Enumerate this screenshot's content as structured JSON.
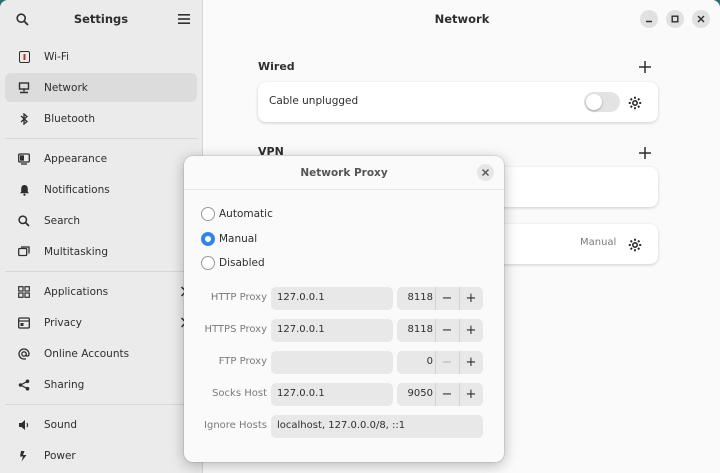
{
  "sidebar": {
    "title": "Settings",
    "items": [
      {
        "label": "Wi-Fi",
        "icon": "wifi-icon"
      },
      {
        "label": "Network",
        "icon": "network-icon",
        "selected": true
      },
      {
        "label": "Bluetooth",
        "icon": "bluetooth-icon"
      },
      {
        "label": "Appearance",
        "icon": "appearance-icon"
      },
      {
        "label": "Notifications",
        "icon": "bell-icon"
      },
      {
        "label": "Search",
        "icon": "search-icon"
      },
      {
        "label": "Multitasking",
        "icon": "multitasking-icon"
      },
      {
        "label": "Applications",
        "icon": "applications-icon"
      },
      {
        "label": "Privacy",
        "icon": "hand-icon"
      },
      {
        "label": "Online Accounts",
        "icon": "at-icon"
      },
      {
        "label": "Sharing",
        "icon": "share-icon"
      },
      {
        "label": "Sound",
        "icon": "speaker-icon"
      },
      {
        "label": "Power",
        "icon": "power-icon"
      }
    ]
  },
  "main": {
    "title": "Network",
    "wired": {
      "title": "Wired",
      "status": "Cable unplugged"
    },
    "vpn": {
      "title": "VPN"
    },
    "proxy_row": {
      "value": "Manual"
    }
  },
  "dialog": {
    "title": "Network Proxy",
    "modes": [
      "Automatic",
      "Manual",
      "Disabled"
    ],
    "selected_mode": "Manual",
    "rows": [
      {
        "label": "HTTP Proxy",
        "host": "127.0.0.1",
        "port": "8118"
      },
      {
        "label": "HTTPS Proxy",
        "host": "127.0.0.1",
        "port": "8118"
      },
      {
        "label": "FTP Proxy",
        "host": "",
        "port": "0"
      },
      {
        "label": "Socks Host",
        "host": "127.0.0.1",
        "port": "9050"
      }
    ],
    "ignore": {
      "label": "Ignore Hosts",
      "value": "localhost, 127.0.0.0/8, ::1"
    }
  },
  "colors": {
    "accent": "#3584e4"
  }
}
